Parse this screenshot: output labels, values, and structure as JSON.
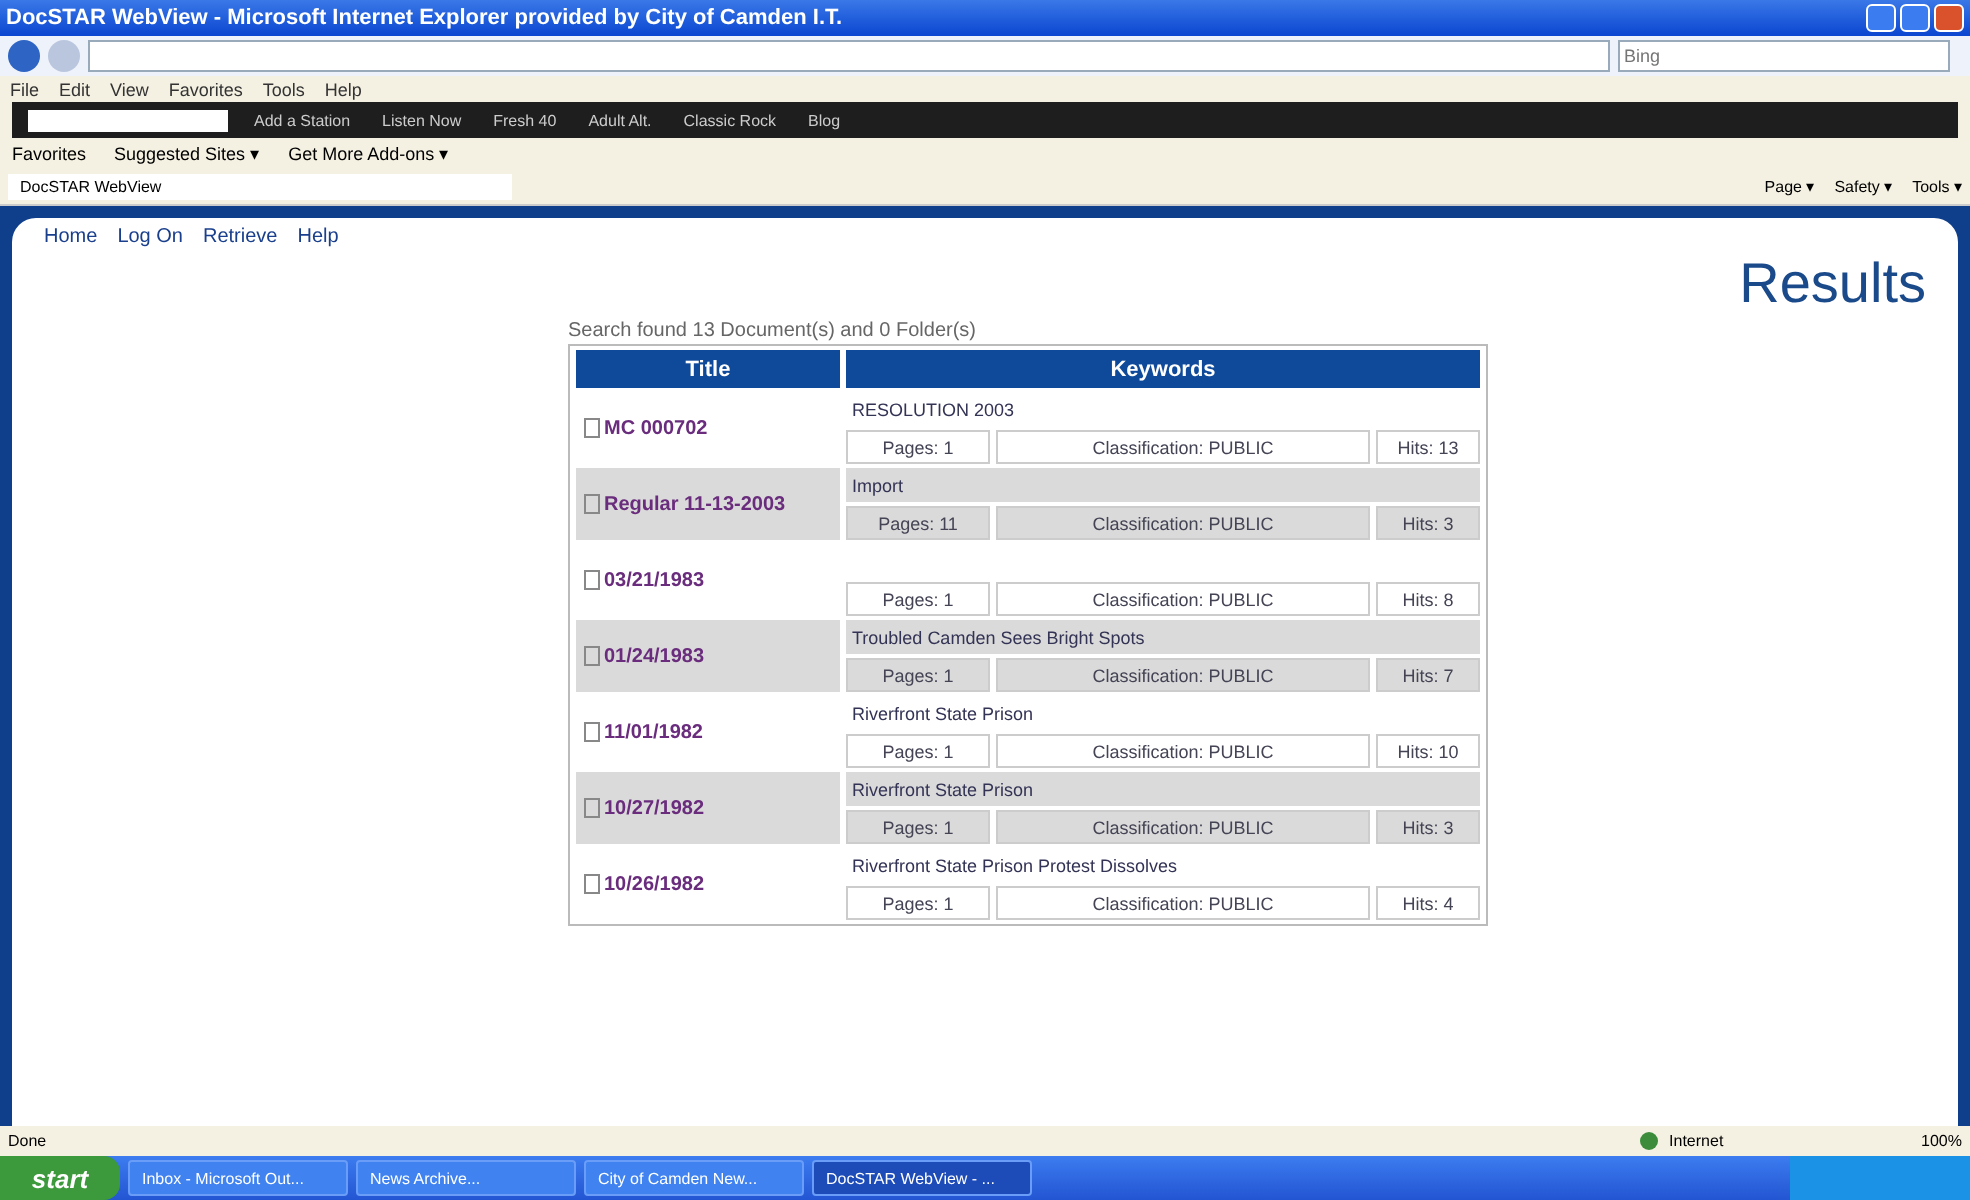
{
  "window": {
    "title": "DocSTAR WebView - Microsoft Internet Explorer provided by City of Camden I.T."
  },
  "search_box": {
    "placeholder": "Bing"
  },
  "menu": [
    "File",
    "Edit",
    "View",
    "Favorites",
    "Tools",
    "Help"
  ],
  "radio_toolbar": [
    "Add a Station",
    "Listen Now",
    "Fresh 40",
    "Adult Alt.",
    "Classic Rock",
    "Blog"
  ],
  "favorites_bar": {
    "label": "Favorites",
    "links": [
      "Suggested Sites ▾",
      "Get More Add-ons ▾"
    ]
  },
  "tab": {
    "label": "DocSTAR WebView"
  },
  "command_bar": [
    "Page ▾",
    "Safety ▾",
    "Tools ▾"
  ],
  "site_nav": [
    "Home",
    "Log On",
    "Retrieve",
    "Help"
  ],
  "heading": "Results",
  "summary": "Search found 13 Document(s) and 0 Folder(s)",
  "table": {
    "columns": [
      "Title",
      "Keywords"
    ],
    "rows": [
      {
        "title": "MC 000702",
        "keywords": "RESOLUTION 2003",
        "pages": "Pages: 1",
        "classification": "Classification: PUBLIC",
        "hits": "Hits: 13"
      },
      {
        "title": "Regular 11-13-2003",
        "keywords": "Import",
        "pages": "Pages: 11",
        "classification": "Classification: PUBLIC",
        "hits": "Hits: 3"
      },
      {
        "title": "03/21/1983",
        "keywords": "",
        "pages": "Pages: 1",
        "classification": "Classification: PUBLIC",
        "hits": "Hits: 8"
      },
      {
        "title": "01/24/1983",
        "keywords": "Troubled Camden Sees Bright Spots",
        "pages": "Pages: 1",
        "classification": "Classification: PUBLIC",
        "hits": "Hits: 7"
      },
      {
        "title": "11/01/1982",
        "keywords": "Riverfront State Prison",
        "pages": "Pages: 1",
        "classification": "Classification: PUBLIC",
        "hits": "Hits: 10"
      },
      {
        "title": "10/27/1982",
        "keywords": "Riverfront State Prison",
        "pages": "Pages: 1",
        "classification": "Classification: PUBLIC",
        "hits": "Hits: 3"
      },
      {
        "title": "10/26/1982",
        "keywords": "Riverfront State Prison Protest Dissolves",
        "pages": "Pages: 1",
        "classification": "Classification: PUBLIC",
        "hits": "Hits: 4"
      }
    ]
  },
  "status_bar": {
    "text": "Done",
    "zone": "Internet",
    "zoom": "100%"
  },
  "taskbar": {
    "start": "start",
    "items": [
      {
        "label": "Inbox - Microsoft Out...",
        "selected": false
      },
      {
        "label": "News Archive...",
        "selected": false
      },
      {
        "label": "City of Camden New...",
        "selected": false
      },
      {
        "label": "DocSTAR WebView - ...",
        "selected": true
      }
    ]
  }
}
